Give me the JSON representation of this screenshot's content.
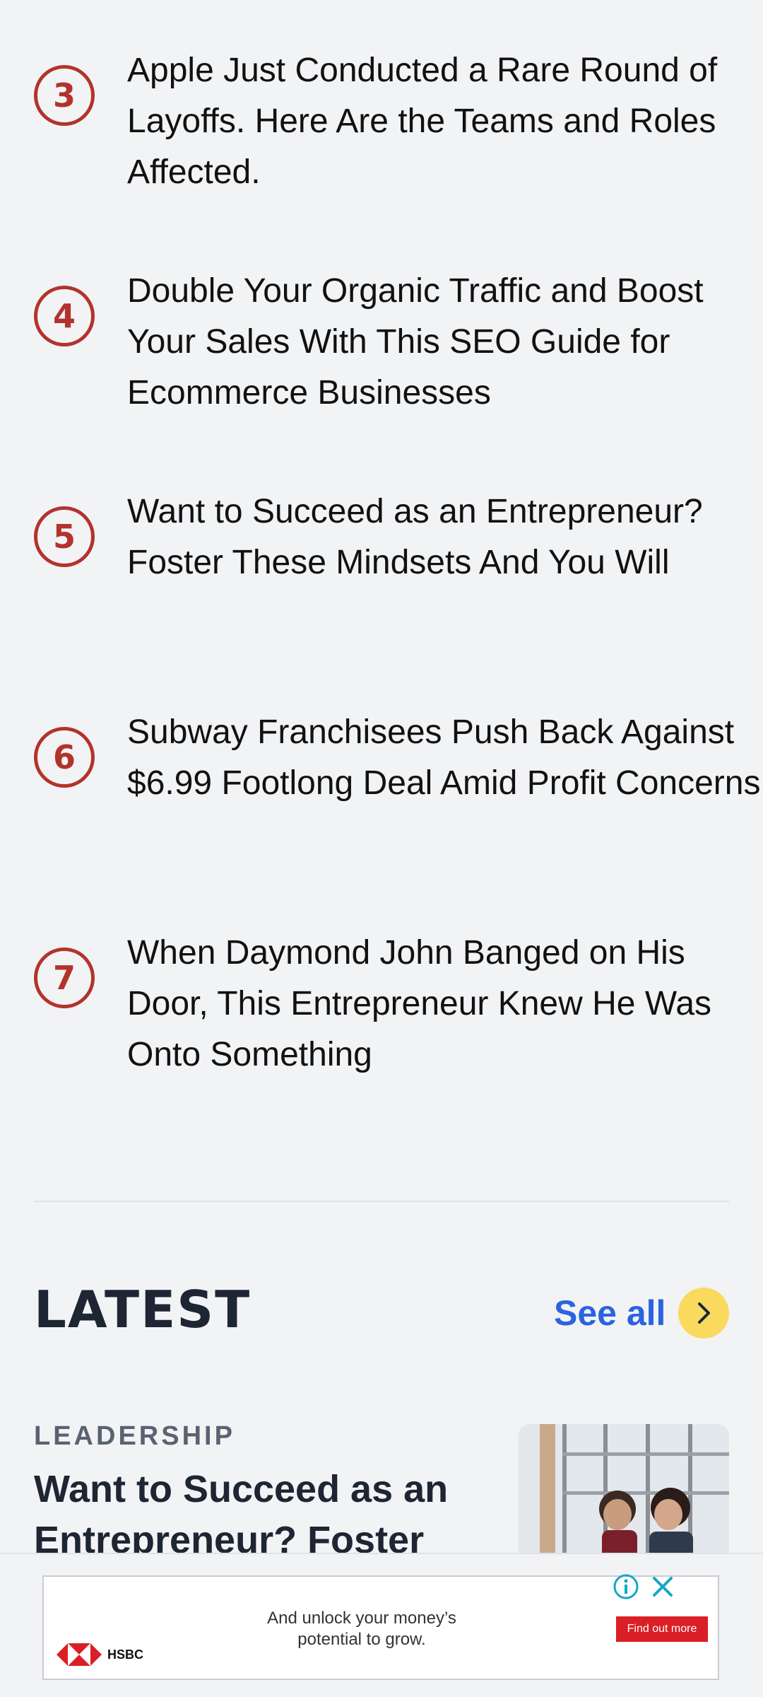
{
  "ranked_list": [
    {
      "rank": "3",
      "title": "Apple Just Conducted a Rare Round of Layoffs. Here Are the Teams and Roles Affected."
    },
    {
      "rank": "4",
      "title": "Double Your Organic Traffic and Boost Your Sales With This SEO Guide for Ecommerce Businesses"
    },
    {
      "rank": "5",
      "title": "Want to Succeed as an Entrepreneur? Foster These Mindsets And You Will"
    },
    {
      "rank": "6",
      "title": "Subway Franchisees Push Back Against $6.99 Footlong Deal Amid Profit Concerns"
    },
    {
      "rank": "7",
      "title": "When Daymond John Banged on His Door, This Entrepreneur Knew He Was Onto Something"
    }
  ],
  "latest": {
    "heading": "LATEST",
    "see_all": "See all",
    "article": {
      "category": "LEADERSHIP",
      "title": "Want to Succeed as an Entrepreneur? Foster"
    }
  },
  "ad": {
    "text": "And unlock your money’s potential to grow.",
    "cta": "Find out more",
    "brand": "HSBC"
  },
  "colors": {
    "rank_accent": "#b3332c",
    "link": "#2b63e0",
    "arrow_bg": "#fada5e",
    "ad_cta": "#db1f26"
  },
  "icons": {
    "see_all": "chevron-right-icon",
    "ad_info": "info-icon",
    "ad_close": "close-icon"
  }
}
